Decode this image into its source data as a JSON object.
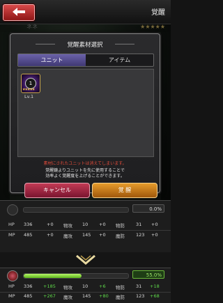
{
  "header": {
    "title": "覚醒",
    "sub_left": "ネネ",
    "sub_stars": "★★★★★"
  },
  "dialog": {
    "title": "覚醒素材選択",
    "tabs": [
      {
        "label": "ユニット",
        "active": true
      },
      {
        "label": "アイテム",
        "active": false
      }
    ],
    "unit": {
      "level_badge": "1",
      "stars": "★★★★★",
      "level_text": "Lv.1"
    },
    "warning": "素材にされたユニットは消えてしまいます。",
    "desc_line1": "覚醒鏡よりユニットを先に使用することで",
    "desc_line2": "効率よく覚醒度を上げることができます。",
    "cancel_label": "キャンセル",
    "awaken_label": "覚 醒"
  },
  "panel_current": {
    "percent": "0.0%",
    "progress": 0.0,
    "rows": [
      {
        "a_lbl": "HP",
        "a_val": "336",
        "a_add": "+0",
        "b_lbl": "物攻",
        "b_val": "10",
        "b_add": "+0",
        "c_lbl": "物防",
        "c_val": "31",
        "c_add": "+0"
      },
      {
        "a_lbl": "MP",
        "a_val": "485",
        "a_add": "+0",
        "b_lbl": "魔攻",
        "b_val": "145",
        "b_add": "+0",
        "c_lbl": "魔防",
        "c_val": "123",
        "c_add": "+0"
      }
    ]
  },
  "panel_after": {
    "percent": "55.0%",
    "progress": 0.55,
    "rows": [
      {
        "a_lbl": "HP",
        "a_val": "336",
        "a_add": "+185",
        "b_lbl": "物攻",
        "b_val": "10",
        "b_add": "+6",
        "c_lbl": "物防",
        "c_val": "31",
        "c_add": "+18"
      },
      {
        "a_lbl": "MP",
        "a_val": "485",
        "a_add": "+267",
        "b_lbl": "魔攻",
        "b_val": "145",
        "b_add": "+80",
        "c_lbl": "魔防",
        "c_val": "123",
        "c_add": "+68"
      }
    ]
  },
  "colors": {
    "accent_green": "#5fd94a",
    "warning_red": "#e04b3a",
    "cancel_red": "#c23a54",
    "awaken_orange": "#e69b2b",
    "tab_purple": "#6b62a9"
  }
}
